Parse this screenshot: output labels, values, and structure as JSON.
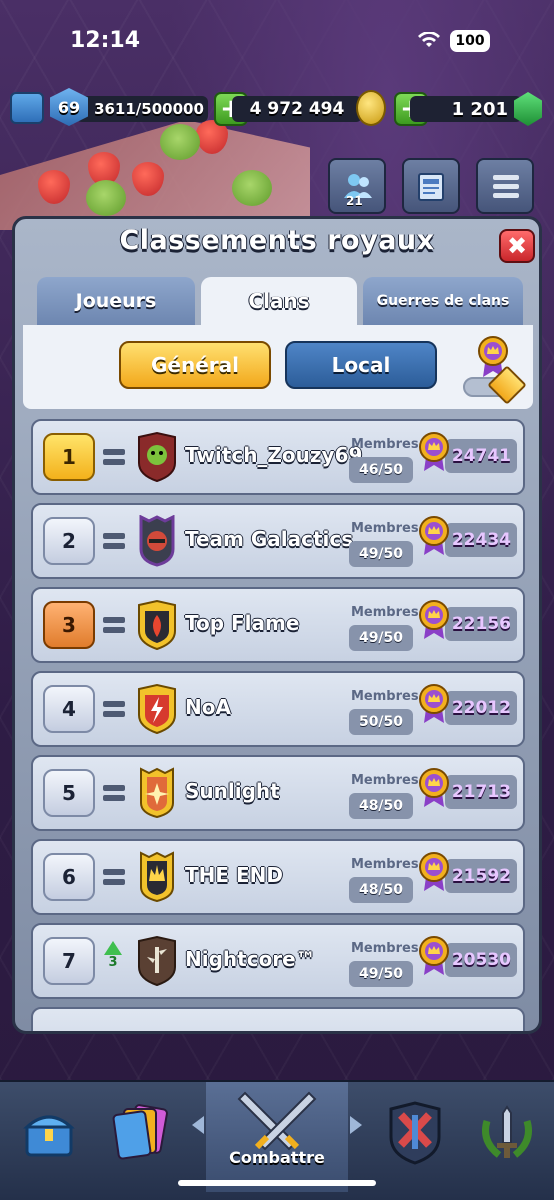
{
  "status": {
    "time": "12:14",
    "battery": "100"
  },
  "resources": {
    "level": "69",
    "xp": "3611/500000",
    "gold": "4 972 494",
    "gems": "1 201"
  },
  "side_buttons": {
    "friends_count": "21"
  },
  "panel": {
    "title": "Classements royaux",
    "close": "✖",
    "tabs": [
      "Joueurs",
      "Clans",
      "Guerres de clans"
    ],
    "filters": {
      "general": "Général",
      "local": "Local"
    }
  },
  "clans": [
    {
      "rank": "1",
      "change": "=",
      "name": "Twitch_Zouzy69",
      "members_label": "Membres",
      "members": "46/50",
      "trophies": "24741"
    },
    {
      "rank": "2",
      "change": "=",
      "name": "Team Galactics",
      "members_label": "Membres",
      "members": "49/50",
      "trophies": "22434"
    },
    {
      "rank": "3",
      "change": "=",
      "name": "Top Flame",
      "members_label": "Membres",
      "members": "49/50",
      "trophies": "22156"
    },
    {
      "rank": "4",
      "change": "=",
      "name": "NoA",
      "members_label": "Membres",
      "members": "50/50",
      "trophies": "22012"
    },
    {
      "rank": "5",
      "change": "=",
      "name": "Sunlight",
      "members_label": "Membres",
      "members": "48/50",
      "trophies": "21713"
    },
    {
      "rank": "6",
      "change": "=",
      "name": "THE END",
      "members_label": "Membres",
      "members": "48/50",
      "trophies": "21592"
    },
    {
      "rank": "7",
      "change": "up",
      "change_value": "3",
      "name": "Nightcore™",
      "members_label": "Membres",
      "members": "49/50",
      "trophies": "20530"
    }
  ],
  "nav": {
    "active_label": "Combattre"
  },
  "colors": {
    "gold_tab": "#f2a81b",
    "blue_tab": "#2c5d99",
    "trophy_purple": "#9b4fd1"
  }
}
